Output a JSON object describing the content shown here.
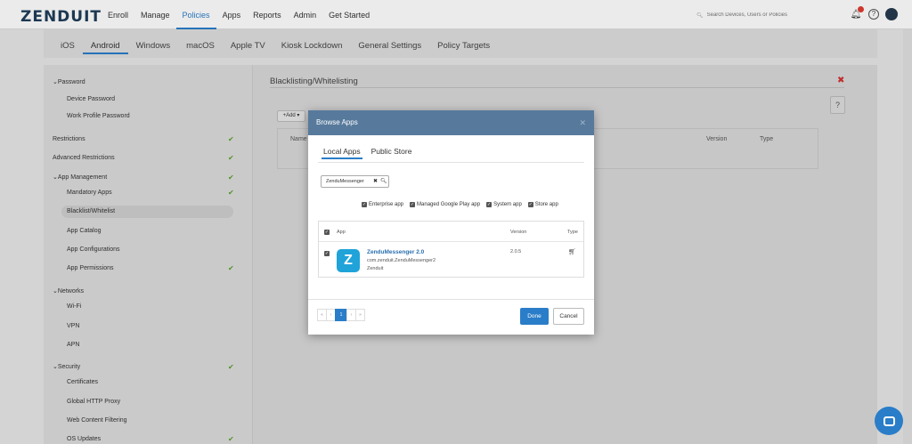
{
  "brand": "ZENDUIT",
  "nav": [
    "Enroll",
    "Manage",
    "Policies",
    "Apps",
    "Reports",
    "Admin",
    "Get Started"
  ],
  "nav_active": "Policies",
  "search_placeholder": "Search Devices, Users or Policies",
  "subtabs": [
    "iOS",
    "Android",
    "Windows",
    "macOS",
    "Apple TV",
    "Kiosk Lockdown",
    "General Settings",
    "Policy Targets"
  ],
  "subtab_active": "Android",
  "sidebar": {
    "password": "Password",
    "device_password": "Device Password",
    "work_profile_password": "Work Profile Password",
    "restrictions": "Restrictions",
    "advanced_restrictions": "Advanced Restrictions",
    "app_management": "App Management",
    "mandatory_apps": "Mandatory Apps",
    "blacklist_whitelist": "Blacklist/Whitelist",
    "app_catalog": "App Catalog",
    "app_configurations": "App Configurations",
    "app_permissions": "App Permissions",
    "networks": "Networks",
    "wifi": "Wi-Fi",
    "vpn": "VPN",
    "apn": "APN",
    "security": "Security",
    "certificates": "Certificates",
    "global_http_proxy": "Global HTTP Proxy",
    "web_content_filtering": "Web Content Filtering",
    "os_updates": "OS Updates"
  },
  "main": {
    "title": "Blacklisting/Whitelisting",
    "add_label": "+Add ▾",
    "help": "?",
    "col_name": "Name",
    "col_version": "Version",
    "col_type": "Type"
  },
  "modal": {
    "title": "Browse Apps",
    "tab_local": "Local Apps",
    "tab_public": "Public Store",
    "search_value": "ZenduMessenger",
    "filters": [
      "Enterprise app",
      "Managed Google Play app",
      "System app",
      "Store app"
    ],
    "col_app": "App",
    "col_version": "Version",
    "col_type": "Type",
    "app": {
      "name": "ZenduMessenger 2.0",
      "package": "com.zenduit.ZenduMessenger2",
      "vendor": "Zenduit",
      "version": "2.0.5",
      "icon_letter": "Z"
    },
    "pager_page": "1",
    "done": "Done",
    "cancel": "Cancel"
  },
  "colors": {
    "accent": "#2a7dc8",
    "modal_header": "#577a9c",
    "check": "#5aa02c",
    "danger": "#d32f2f"
  }
}
